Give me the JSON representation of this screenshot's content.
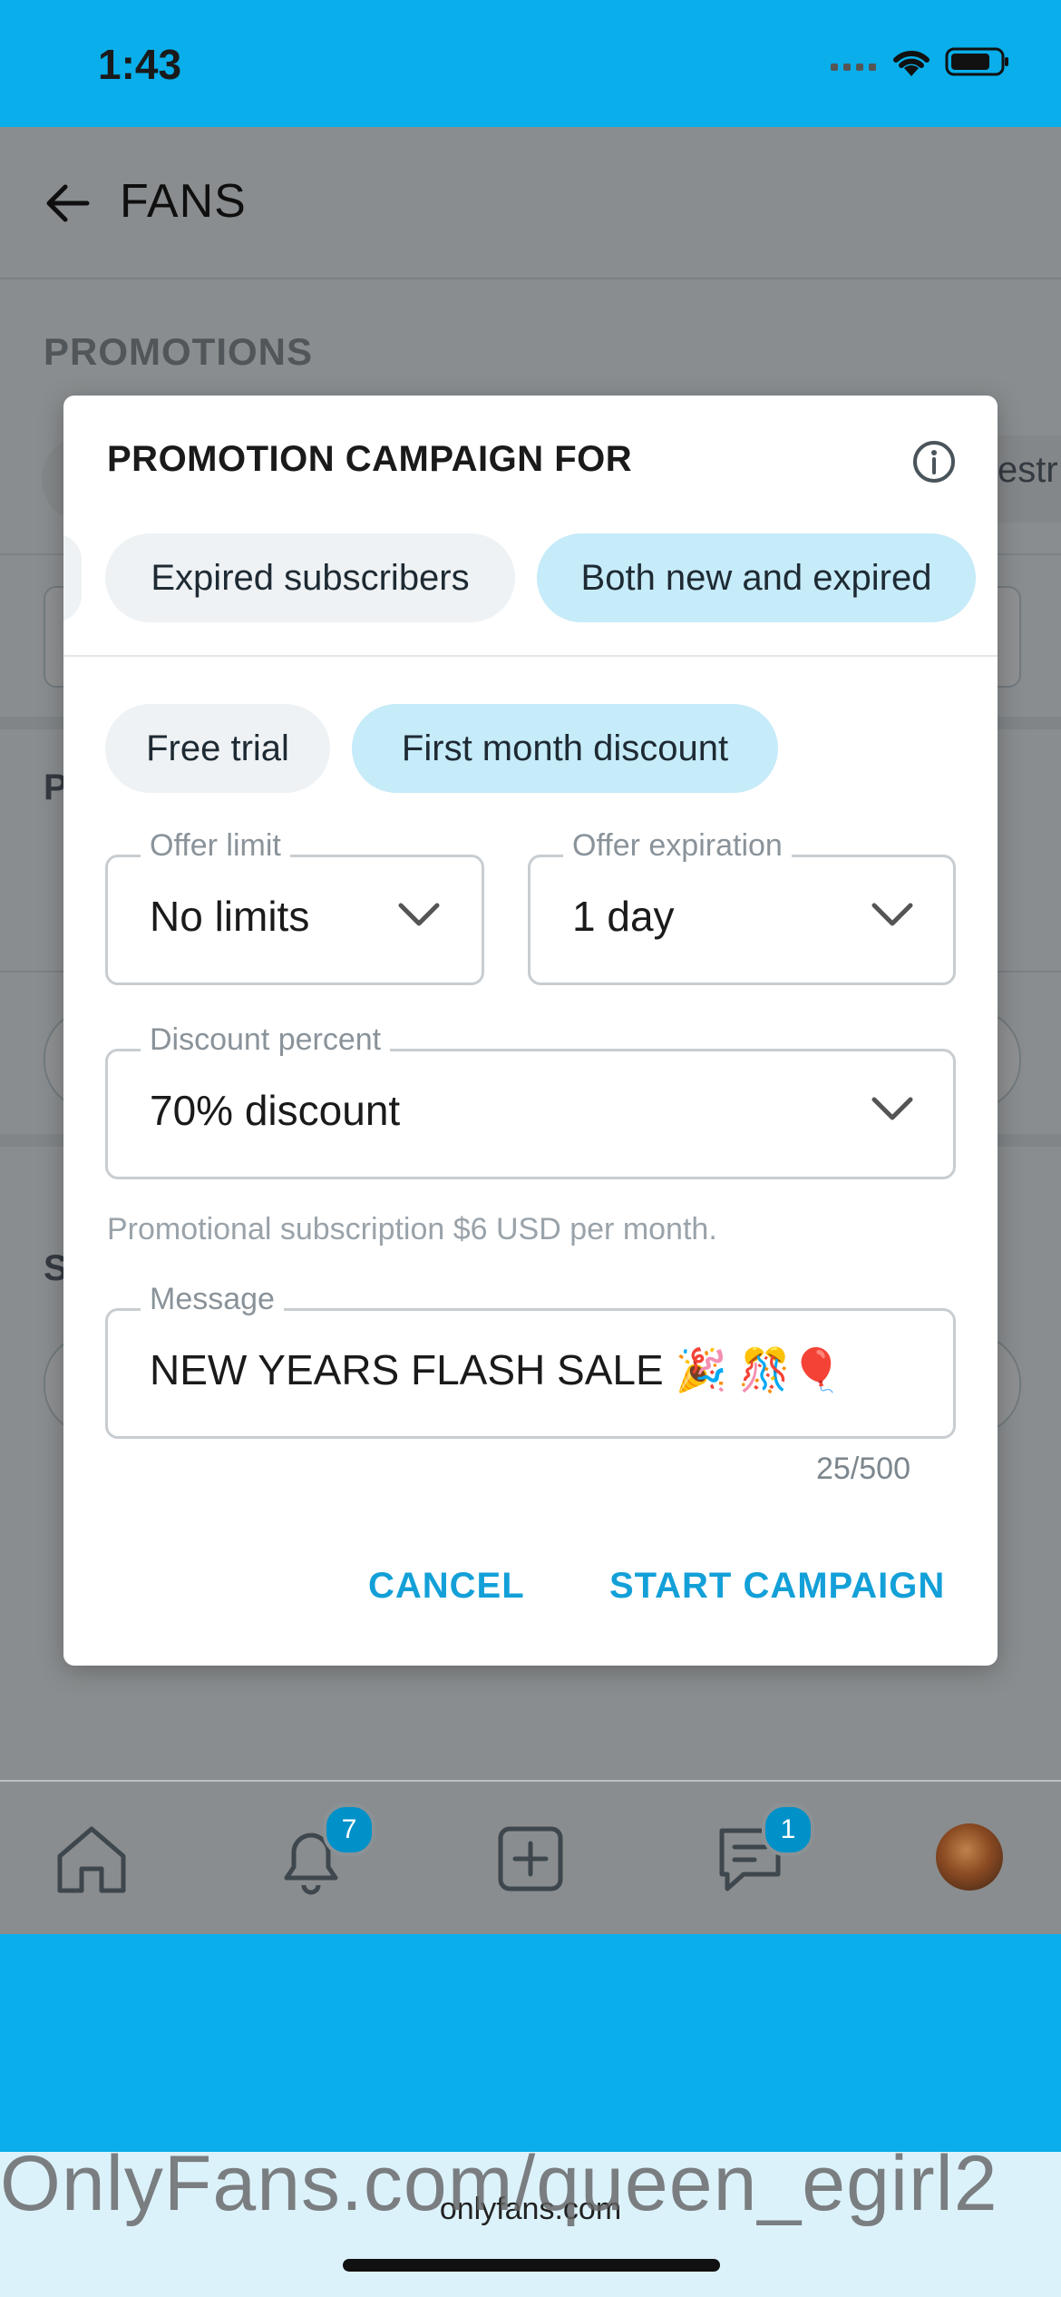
{
  "status_bar": {
    "time": "1:43"
  },
  "background_page": {
    "header_title": "FANS",
    "section_title": "PROMOTIONS",
    "partial_letter_1": "P",
    "partial_letter_2": "S",
    "partial_text_right": "estr",
    "tab_badges": {
      "notifications": "7",
      "messages": "1"
    }
  },
  "modal": {
    "title": "PROMOTION CAMPAIGN FOR",
    "audience_chips": [
      {
        "label": "Expired subscribers",
        "selected": false
      },
      {
        "label": "Both new and expired",
        "selected": true
      }
    ],
    "offer_type_chips": [
      {
        "label": "Free trial",
        "selected": false
      },
      {
        "label": "First month discount",
        "selected": true
      }
    ],
    "offer_limit": {
      "label": "Offer limit",
      "value": "No limits"
    },
    "offer_expiration": {
      "label": "Offer expiration",
      "value": "1 day"
    },
    "discount_percent": {
      "label": "Discount percent",
      "value": "70% discount"
    },
    "helper_text": "Promotional subscription $6 USD per month.",
    "message": {
      "label": "Message",
      "value": "NEW YEARS FLASH SALE 🎉 🎊🎈",
      "counter": "25/500"
    },
    "cancel_label": "CANCEL",
    "start_label": "START CAMPAIGN"
  },
  "browser": {
    "url": "onlyfans.com"
  },
  "watermark": "OnlyFans.com/queen_egirl2",
  "colors": {
    "accent": "#13a0d8",
    "brand_blue": "#09aeea",
    "chip_selected": "#c6ebf9",
    "chip_unselected": "#eef2f4"
  }
}
